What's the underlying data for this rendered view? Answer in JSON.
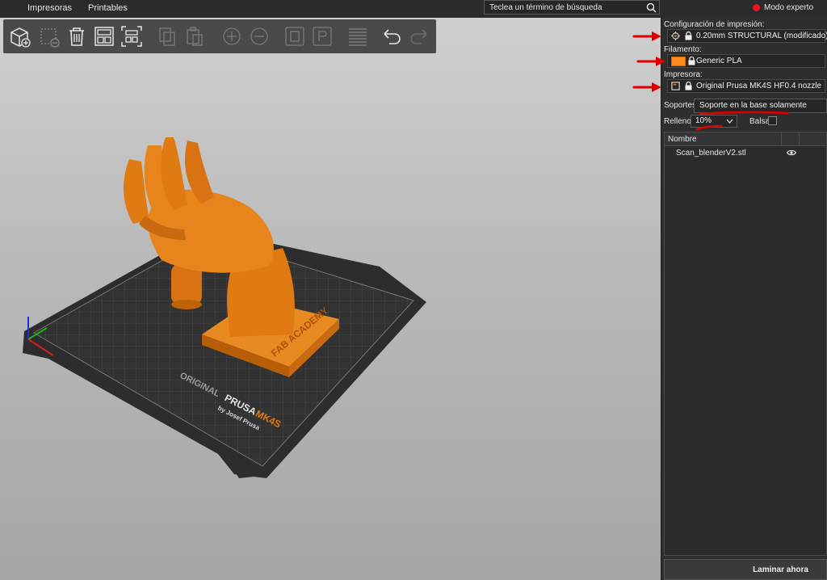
{
  "topbar": {
    "tabs": [
      "Impresoras",
      "Printables"
    ],
    "search_placeholder": "Teclea un término de búsqueda",
    "mode_label": "Modo experto",
    "mode_color": "#e8141f"
  },
  "toolbar": {
    "tools": [
      "add-object-icon",
      "delete-icon",
      "delete-all-icon",
      "arrange-icon",
      "split-icon",
      "copy-icon",
      "paste-icon",
      "add-instance-icon",
      "remove-instance-icon",
      "split-objects-icon",
      "split-parts-icon",
      "layers-icon",
      "undo-icon",
      "redo-icon"
    ]
  },
  "viewport": {
    "bed_brand_1": "ORIGINAL",
    "bed_brand_2": "PRUSA",
    "bed_brand_3": "MK4S",
    "bed_brand_4": "by Josef Prusa",
    "model_base_text": "FAB ACADEMY",
    "model_color": "#e07a12"
  },
  "sidebar": {
    "print_settings_label": "Configuración de impresión:",
    "print_profile": "0.20mm STRUCTURAL (modificado)",
    "filament_label": "Filamento:",
    "filament_profile": "Generic PLA",
    "filament_color": "#ff8c1a",
    "printer_label": "Impresora:",
    "printer_profile": "Original Prusa MK4S HF0.4 nozzle",
    "supports_label": "Soportes:",
    "supports_value": "Soporte en la base solamente",
    "infill_label": "Relleno:",
    "infill_value": "10%",
    "raft_label": "Balsa:",
    "object_list_header": "Nombre",
    "objects": [
      "Scan_blenderV2.stl"
    ],
    "slice_button": "Laminar ahora",
    "annotation_color": "#e10000"
  }
}
